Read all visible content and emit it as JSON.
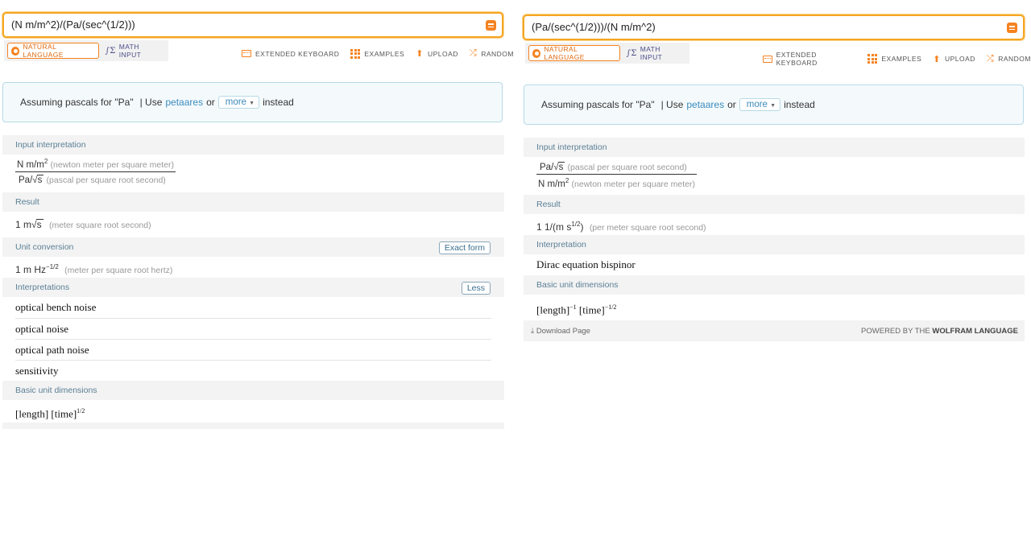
{
  "left": {
    "query": "(N m/m^2)/(Pa/(sec^(1/2)))",
    "modes": {
      "natural": "NATURAL LANGUAGE",
      "math": "MATH INPUT"
    },
    "toolbar": {
      "keyboard": "EXTENDED KEYBOARD",
      "examples": "EXAMPLES",
      "upload": "UPLOAD",
      "random": "RANDOM"
    },
    "assume": {
      "prefix": "Assuming pascals for \"Pa\"",
      "sep": "| Use",
      "link": "petaares",
      "or": "or",
      "more": "more",
      "suffix": "instead"
    },
    "input_header": "Input interpretation",
    "input_num": "N m/m",
    "input_num_exp": "2",
    "input_num_desc": "(newton meter per square meter)",
    "input_den": "Pa/",
    "input_den_rad": "s",
    "input_den_desc": "(pascal per square root second)",
    "result_header": "Result",
    "result_value": "1 m",
    "result_rad": "s",
    "result_desc": "(meter square root second)",
    "unit_header": "Unit conversion",
    "unit_button": "Exact form",
    "unit_value": "1 m Hz",
    "unit_exp": "−1/2",
    "unit_desc": "(meter per square root hertz)",
    "interp_header": "Interpretations",
    "interp_button": "Less",
    "interpretations": [
      "optical bench noise",
      "optical noise",
      "optical path noise",
      "sensitivity"
    ],
    "dims_header": "Basic unit dimensions",
    "dims_a": "[length] [time]",
    "dims_exp": "1/2"
  },
  "right": {
    "query": "(Pa/(sec^(1/2)))/(N m/m^2)",
    "modes": {
      "natural": "NATURAL LANGUAGE",
      "math": "MATH INPUT"
    },
    "toolbar": {
      "keyboard": "EXTENDED KEYBOARD",
      "examples": "EXAMPLES",
      "upload": "UPLOAD",
      "random": "RANDOM"
    },
    "assume": {
      "prefix": "Assuming pascals for \"Pa\"",
      "sep": "| Use",
      "link": "petaares",
      "or": "or",
      "more": "more",
      "suffix": "instead"
    },
    "input_header": "Input interpretation",
    "input_num": "Pa/",
    "input_num_rad": "s",
    "input_num_desc": "(pascal per square root second)",
    "input_den": "N m/m",
    "input_den_exp": "2",
    "input_den_desc": "(newton meter per square meter)",
    "result_header": "Result",
    "result_value": "1 1/(m s",
    "result_exp": "1/2",
    "result_close": ")",
    "result_desc": "(per meter square root second)",
    "interp_header": "Interpretation",
    "interp_value": "Dirac equation bispinor",
    "dims_header": "Basic unit dimensions",
    "dims_a": "[length]",
    "dims_a_exp": "−1",
    "dims_b": "[time]",
    "dims_b_exp": "−1/2",
    "download": "Download Page",
    "powered_prefix": "POWERED BY THE",
    "powered_brand": "WOLFRAM LANGUAGE"
  }
}
